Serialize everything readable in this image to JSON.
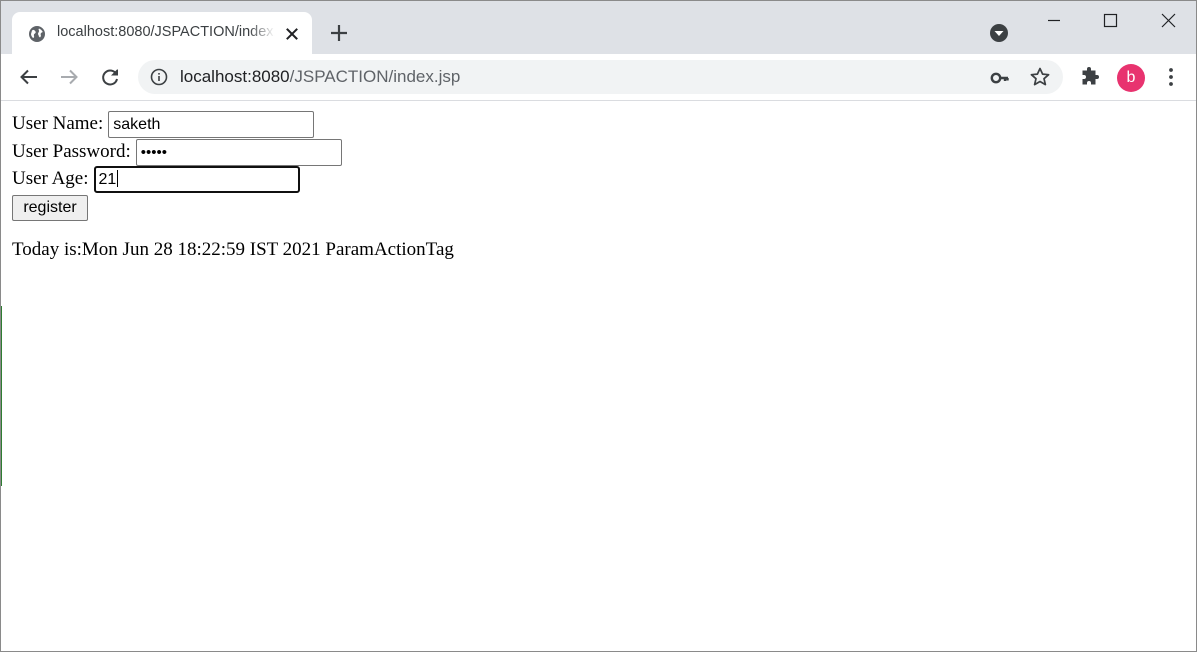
{
  "browser": {
    "tab": {
      "title": "localhost:8080/JSPACTION/index.jsp",
      "favicon": "globe-icon"
    },
    "address_bar": {
      "host": "localhost:8080",
      "path": "/JSPACTION/index.jsp"
    },
    "profile_initial": "b",
    "profile_color": "#e8336f",
    "icons": [
      "back-arrow-icon",
      "forward-arrow-icon",
      "reload-icon",
      "info-icon",
      "key-icon",
      "star-icon",
      "puzzle-icon",
      "kebab-menu-icon"
    ]
  },
  "form": {
    "username_label": "User Name:",
    "username_value": "saketh",
    "password_label": "User Password:",
    "password_mask": "•••••",
    "age_label": "User Age:",
    "age_value": "21",
    "submit_label": "register"
  },
  "output": {
    "today_text": "Today is:Mon Jun 28 18:22:59 IST 2021 ParamActionTag"
  }
}
